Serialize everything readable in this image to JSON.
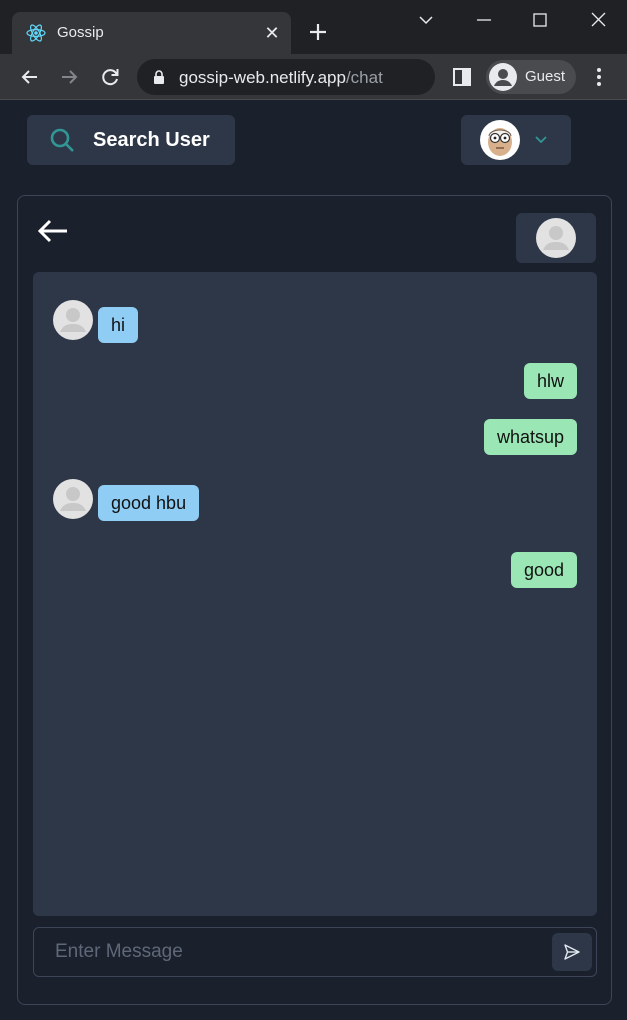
{
  "browser": {
    "tab_title": "Gossip",
    "url_host": "gossip-web.netlify.app",
    "url_path": "/chat",
    "profile_label": "Guest"
  },
  "header": {
    "search_label": "Search User"
  },
  "messages": [
    {
      "side": "in",
      "text": "hi",
      "show_avatar": true
    },
    {
      "side": "out",
      "text": "hlw"
    },
    {
      "side": "out",
      "text": "whatsup"
    },
    {
      "side": "in",
      "text": "good hbu",
      "show_avatar": true
    },
    {
      "side": "out",
      "text": "good"
    }
  ],
  "composer": {
    "placeholder": "Enter Message"
  },
  "colors": {
    "incoming": "#90cdf4",
    "outgoing": "#9ae6b4",
    "panel": "#2d3748",
    "background": "#1a202c",
    "accent": "#319795"
  }
}
